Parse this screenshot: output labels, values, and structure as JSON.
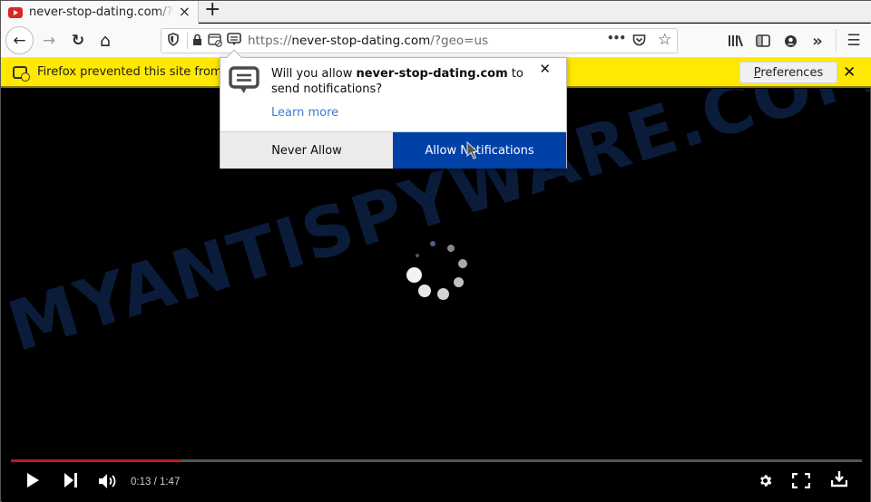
{
  "tab": {
    "title": "never-stop-dating.com/?geo=us",
    "favicon": "youtube-play-icon",
    "close_icon": "×",
    "new_tab_icon": "+"
  },
  "navbar": {
    "back_icon": "←",
    "forward_icon": "→",
    "reload_icon": "↻",
    "home_icon": "⌂",
    "url_scheme": "https://",
    "url_host": "never-stop-dating.com",
    "url_path": "/?geo=us",
    "page_actions_icon": "•••",
    "pocket_icon": "pocket-icon",
    "bookmark_icon": "☆",
    "library_icon": "library-icon",
    "sidebar_icon": "sidebar-icon",
    "account_icon": "account-icon",
    "overflow_icon": "»",
    "menu_icon": "☰"
  },
  "notification_bar": {
    "text": "Firefox prevented this site from",
    "preferences_label": "Preferences",
    "preferences_accesskey": "P",
    "close_icon": "✕"
  },
  "permission_popup": {
    "message_prefix": "Will you allow ",
    "message_host": "never-stop-dating.com",
    "message_suffix": " to send notifications?",
    "learn_more": "Learn more",
    "close_icon": "✕",
    "never_allow_label": "Never Allow",
    "allow_label": "Allow Notifications"
  },
  "video": {
    "watermark": "MYANTISPYWARE.COM",
    "current_time": "0:13",
    "duration": "1:47",
    "time_display": "0:13 / 1:47",
    "progress_fraction": 0.2,
    "accent_color": "#c4171f"
  }
}
